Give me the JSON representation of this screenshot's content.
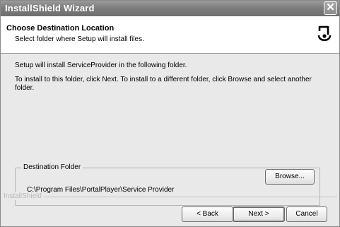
{
  "window": {
    "title": "InstallShield Wizard",
    "close_glyph": "✕"
  },
  "header": {
    "title": "Choose Destination Location",
    "subtitle": "Select folder where Setup will install files.",
    "icon": "installshield-logo-icon"
  },
  "body": {
    "line1": "Setup will install ServiceProvider in the following folder.",
    "line2": "To install to this folder, click Next. To install to a different folder, click Browse and select another",
    "line3": "folder."
  },
  "destination": {
    "legend": "Destination Folder",
    "path": "C:\\Program Files\\PortalPlayer\\Service Provider",
    "browse_label": "Browse..."
  },
  "footer": {
    "brand": "InstallShield",
    "back_label": "< Back",
    "next_label": "Next >",
    "cancel_label": "Cancel"
  }
}
